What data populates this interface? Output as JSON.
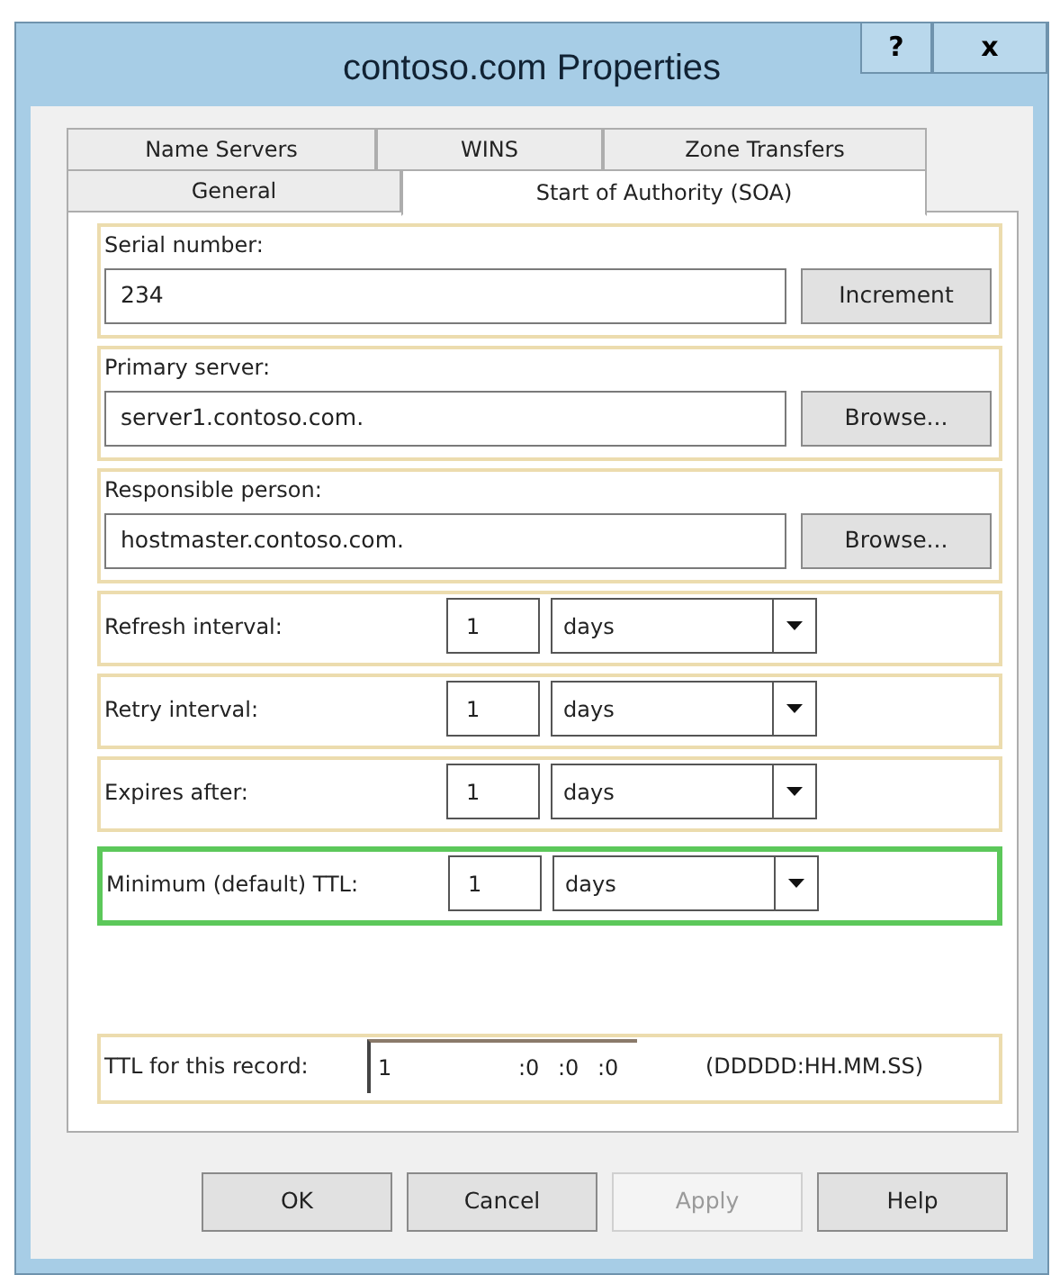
{
  "window": {
    "title": "contoso.com Properties",
    "title_buttons": [
      "?",
      "x"
    ]
  },
  "tabs": {
    "back_row": [
      {
        "label": "Name Servers",
        "selected": false
      },
      {
        "label": "WINS",
        "selected": false
      },
      {
        "label": "Zone Transfers",
        "selected": false
      }
    ],
    "front_row": [
      {
        "label": "General",
        "selected": false
      },
      {
        "label": "Start of Authority (SOA)",
        "selected": true
      }
    ]
  },
  "text_fields": [
    {
      "label": "Serial number:",
      "value": "234",
      "button": "Increment"
    },
    {
      "label": "Primary server:",
      "value": "server1.contoso.com.",
      "button": "Browse..."
    },
    {
      "label": "Responsible person:",
      "value": "hostmaster.contoso.com.",
      "button": "Browse..."
    }
  ],
  "intervals": [
    {
      "label": "Refresh interval:",
      "value": "1",
      "unit": "days",
      "highlighted": false
    },
    {
      "label": "Retry interval:",
      "value": "1",
      "unit": "days",
      "highlighted": false
    },
    {
      "label": "Expires after:",
      "value": "1",
      "unit": "days",
      "highlighted": false
    },
    {
      "label": "Minimum (default) TTL:",
      "value": "1",
      "unit": "days",
      "highlighted": true
    }
  ],
  "record_ttl": {
    "label": "TTL for this record:",
    "days": "1",
    "hours": ":0",
    "minutes": ":0",
    "seconds": ":0",
    "format": "(DDDDD:HH.MM.SS)"
  },
  "buttons": [
    {
      "label": "OK",
      "disabled": false
    },
    {
      "label": "Cancel",
      "disabled": false
    },
    {
      "label": "Apply",
      "disabled": true
    },
    {
      "label": "Help",
      "disabled": false
    }
  ]
}
